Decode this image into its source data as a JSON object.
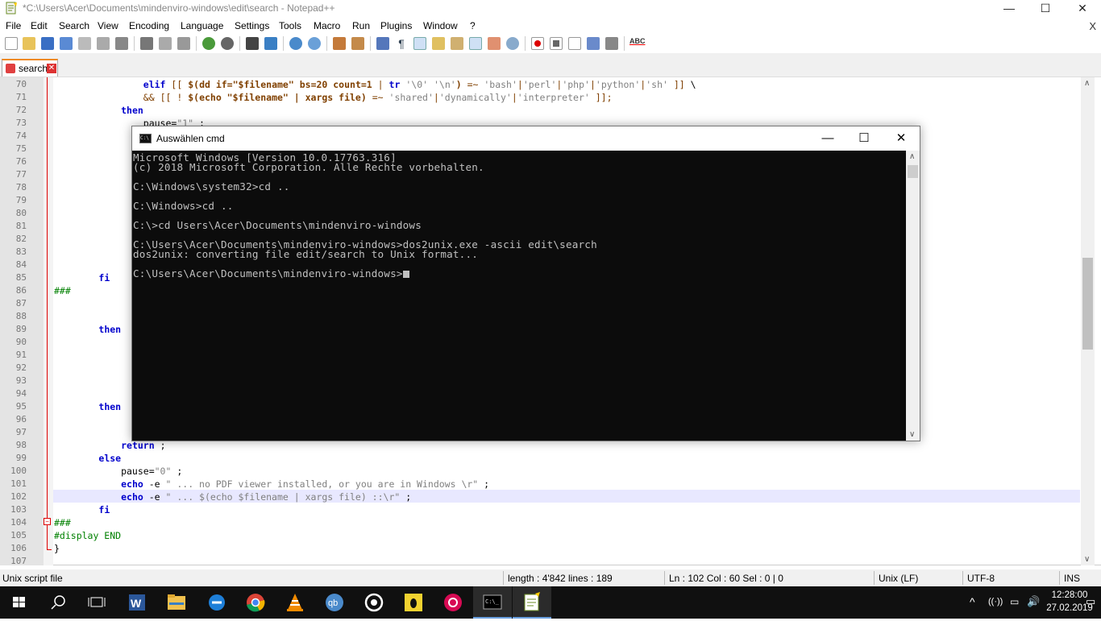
{
  "window": {
    "title": "*C:\\Users\\Acer\\Documents\\mindenviro-windows\\edit\\search - Notepad++",
    "minimize": "—",
    "maximize": "☐",
    "close": "✕"
  },
  "menu": {
    "items": [
      "File",
      "Edit",
      "Search",
      "View",
      "Encoding",
      "Language",
      "Settings",
      "Tools",
      "Macro",
      "Run",
      "Plugins",
      "Window",
      "?"
    ],
    "close_x": "X"
  },
  "toolbar": {
    "icons": [
      "new-file-icon",
      "open-file-icon",
      "save-icon",
      "save-all-icon",
      "close-icon",
      "close-all-icon",
      "print-icon",
      "cut-icon",
      "copy-icon",
      "paste-icon",
      "undo-icon",
      "redo-icon",
      "find-icon",
      "replace-icon",
      "zoom-in-icon",
      "zoom-out-icon",
      "sync-vertical-icon",
      "sync-horizontal-icon",
      "word-wrap-icon",
      "show-all-chars-icon",
      "indent-guide-icon",
      "doc-map-icon",
      "function-list-icon",
      "folder-workspace-icon",
      "monitoring-icon",
      "record-macro-icon",
      "stop-record-icon",
      "play-macro-icon",
      "run-macro-multiple-icon",
      "save-macro-icon",
      "spell-check-icon"
    ]
  },
  "tab": {
    "label": "search",
    "close": "✕"
  },
  "editor": {
    "lines": [
      {
        "n": "70",
        "html": "                <span class='kw'>elif</span> <span class='op'>[[</span> <span class='var'>$(dd if=</span><span class='var'>\"$filename\"</span> <span class='var'>bs=20 count=1</span> <span class='op'>|</span> <span class='kw'>tr</span> <span class='str'>'\\0'</span> <span class='str'>'\\n'</span><span class='var'>)</span> <span class='op'>=~</span> <span class='str'>'bash'</span><span class='op'>|</span><span class='str'>'perl'</span><span class='op'>|</span><span class='str'>'php'</span><span class='op'>|</span><span class='str'>'python'</span><span class='op'>|</span><span class='str'>'sh'</span> <span class='op'>]]</span> \\"
      },
      {
        "n": "71",
        "html": "                <span class='op'>&amp;&amp;</span> <span class='op'>[[ !</span> <span class='var'>$(echo \"$filename\" | xargs file)</span> <span class='op'>=~</span> <span class='str'>'shared'</span><span class='op'>|</span><span class='str'>'dynamically'</span><span class='op'>|</span><span class='str'>'interpreter'</span> <span class='op'>]];</span>"
      },
      {
        "n": "72",
        "html": "            <span class='kw'>then</span>"
      },
      {
        "n": "73",
        "html": "                pause=<span class='str'>\"1\"</span> ;"
      },
      {
        "n": "74",
        "html": ""
      },
      {
        "n": "75",
        "html": ""
      },
      {
        "n": "76",
        "html": ""
      },
      {
        "n": "77",
        "html": ""
      },
      {
        "n": "78",
        "html": ""
      },
      {
        "n": "79",
        "html": ""
      },
      {
        "n": "80",
        "html": ""
      },
      {
        "n": "81",
        "html": ""
      },
      {
        "n": "82",
        "html": ""
      },
      {
        "n": "83",
        "html": ""
      },
      {
        "n": "84",
        "html": ""
      },
      {
        "n": "85",
        "html": "        <span class='kw'>fi</span>"
      },
      {
        "n": "86",
        "html": "<span class='cm'>###</span>"
      },
      {
        "n": "87",
        "html": ""
      },
      {
        "n": "88",
        "html": ""
      },
      {
        "n": "89",
        "html": "        <span class='kw'>then</span>"
      },
      {
        "n": "90",
        "html": ""
      },
      {
        "n": "91",
        "html": ""
      },
      {
        "n": "92",
        "html": ""
      },
      {
        "n": "93",
        "html": ""
      },
      {
        "n": "94",
        "html": ""
      },
      {
        "n": "95",
        "html": "        <span class='kw'>then</span>"
      },
      {
        "n": "96",
        "html": ""
      },
      {
        "n": "97",
        "html": ""
      },
      {
        "n": "98",
        "html": "            <span class='kw'>return</span> ;"
      },
      {
        "n": "99",
        "html": "        <span class='kw'>else</span>"
      },
      {
        "n": "100",
        "html": "            pause=<span class='str'>\"0\"</span> ;"
      },
      {
        "n": "101",
        "html": "            <span class='kw'>echo</span> -e <span class='str'>\" ... no PDF viewer installed, or you are in Windows \\r\"</span> ;"
      },
      {
        "n": "102",
        "html": "            <span class='kw'>echo</span> -e <span class='str'>\" ... $(echo $filename | xargs file) ::\\r\"</span> ;"
      },
      {
        "n": "103",
        "html": "        <span class='kw'>fi</span>"
      },
      {
        "n": "104",
        "html": "<span class='cm'>###</span>"
      },
      {
        "n": "105",
        "html": "<span class='cm'>#display END</span>"
      },
      {
        "n": "106",
        "html": "}"
      },
      {
        "n": "107",
        "html": ""
      }
    ]
  },
  "status": {
    "filetype": "Unix script file",
    "length": "length : 4'842    lines : 189",
    "position": "Ln : 102    Col : 60    Sel : 0 | 0",
    "eol": "Unix (LF)",
    "encoding": "UTF-8",
    "mode": "INS"
  },
  "cmd": {
    "title": "Auswählen cmd",
    "icon_text": "C:\\",
    "minimize": "—",
    "maximize": "☐",
    "close": "✕",
    "lines": [
      "Microsoft Windows [Version 10.0.17763.316]",
      "(c) 2018 Microsoft Corporation. Alle Rechte vorbehalten.",
      "",
      "C:\\Windows\\system32>cd ..",
      "",
      "C:\\Windows>cd ..",
      "",
      "C:\\>cd Users\\Acer\\Documents\\mindenviro-windows",
      "",
      "C:\\Users\\Acer\\Documents\\mindenviro-windows>dos2unix.exe -ascii edit\\search",
      "dos2unix: converting file edit/search to Unix format...",
      "",
      "C:\\Users\\Acer\\Documents\\mindenviro-windows>"
    ]
  },
  "taskbar": {
    "apps": [
      "windows-start-icon",
      "search-icon",
      "task-view-icon",
      "word-icon",
      "file-explorer-icon",
      "edge-icon",
      "chrome-icon",
      "vlc-icon",
      "qbittorrent-icon",
      "circle-app-icon",
      "linux-tux-icon",
      "debian-icon",
      "cmd-icon",
      "notepadpp-icon"
    ],
    "clock_time": "12:28:00",
    "clock_date": "27.02.2019",
    "tray_chevron": "^",
    "tray_wifi": "((·))",
    "tray_speaker": "🔊",
    "notif": "▭"
  },
  "colors": {
    "keyword": "#0000cc",
    "string": "#808080",
    "comment": "#008000",
    "taskbar": "#101010",
    "cmd_bg": "#0c0c0c"
  }
}
